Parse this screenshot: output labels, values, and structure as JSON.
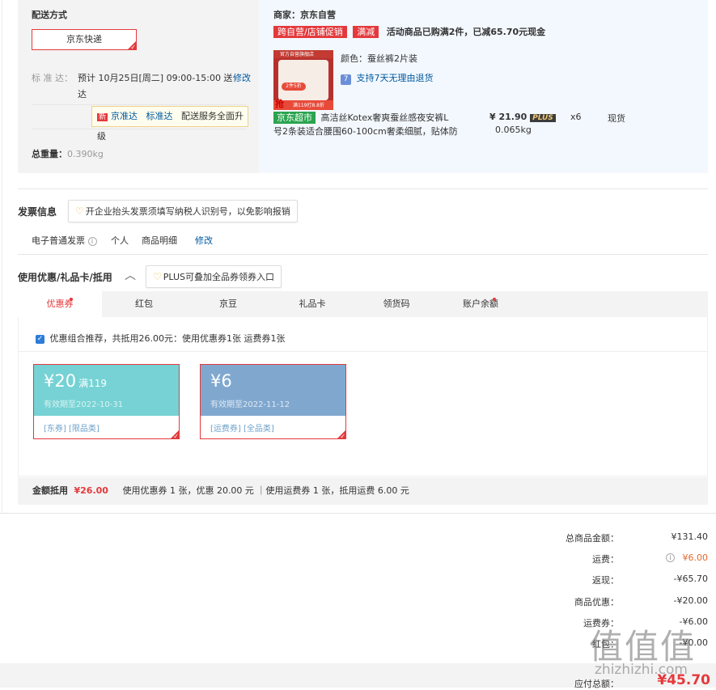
{
  "shipping": {
    "section_title": "配送方式",
    "express_option": "京东快递",
    "standard_label": "标 准 达：",
    "standard_text_line1": "预计 10月25日[周二] 09:00-15:00 送",
    "standard_text_line2": "达",
    "modify_link": "修改",
    "upgrade_tooltip": {
      "badge": "新",
      "link1": "京准达",
      "link2": "标准达",
      "text": "配送服务全面升级"
    },
    "weight_label": "总重量：",
    "weight_value": "0.390kg"
  },
  "merchant": {
    "seller": "商家：京东自营",
    "tag_promo": "跨自营/店铺促销",
    "tag_discount": "满减",
    "promo_text": "活动商品已购满2件，已减65.70元现金",
    "color_label": "颜色：",
    "color_value": "蚕丝裤2片装",
    "return_icon": "7",
    "return_text": "支持7天无理由退货",
    "thumb_text_top": "官方自营旗舰店",
    "thumb_text_bottom": "满119打8.8折",
    "thumb_grab": "抢",
    "thumb_badge": "2件5折",
    "product_badge": "京东超市",
    "product_name_line1": "高洁丝Kotex奢爽蚕丝感夜安裤L",
    "product_name_line2": "号2条装适合腰围60-100cm奢柔细腻，贴体防",
    "price": "¥ 21.90",
    "plus_tag": "PLUS",
    "quantity": "x6",
    "stock": "现货",
    "weight": "0.065kg"
  },
  "invoice": {
    "title": "发票信息",
    "tooltip": "开企业抬头发票须填写纳税人识别号，以免影响报销",
    "type": "电子普通发票",
    "holder": "个人",
    "detail": "商品明细",
    "modify": "修改"
  },
  "coupons": {
    "title": "使用优惠/礼品卡/抵用",
    "tooltip": "PLUS可叠加全品券领券入口",
    "tabs": [
      "优惠券",
      "红包",
      "京豆",
      "礼品卡",
      "领货码",
      "账户余额"
    ],
    "recommend_text": "优惠组合推荐，共抵用26.00元：使用优惠券1张 运费券1张",
    "cards": [
      {
        "amount": "¥20",
        "condition": "满119",
        "expiry": "有效期至2022-10-31",
        "tags": "[东券]  [限品类]",
        "color": "#76d2d4"
      },
      {
        "amount": "¥6",
        "condition": "",
        "expiry": "有效期至2022-11-12",
        "tags": "[运费券]  [全品类]",
        "color": "#80a8cf"
      }
    ],
    "deduct_label": "金额抵用",
    "deduct_amount": "¥26.00",
    "deduct_detail": "使用优惠券 1 张，优惠 20.00 元 ｜使用运费券 1 张，抵用运费 6.00 元"
  },
  "summary": {
    "rows": [
      {
        "label": "总商品金额：",
        "value": "¥131.40"
      },
      {
        "label": "运费：",
        "value": "¥6.00"
      },
      {
        "label": "返现：",
        "value": "-¥65.70"
      },
      {
        "label": "商品优惠：",
        "value": "-¥20.00"
      },
      {
        "label": "运费券：",
        "value": "-¥6.00"
      },
      {
        "label": "红包：",
        "value": "-¥0.00"
      }
    ],
    "total_label": "应付总额：",
    "total_value": "¥45.70"
  },
  "watermark": {
    "chars": "值值值",
    "domain": "zhizhizhi.com"
  },
  "colors": {
    "accent": "#e4393c",
    "link": "#005aa0",
    "orange": "#e8682c"
  }
}
